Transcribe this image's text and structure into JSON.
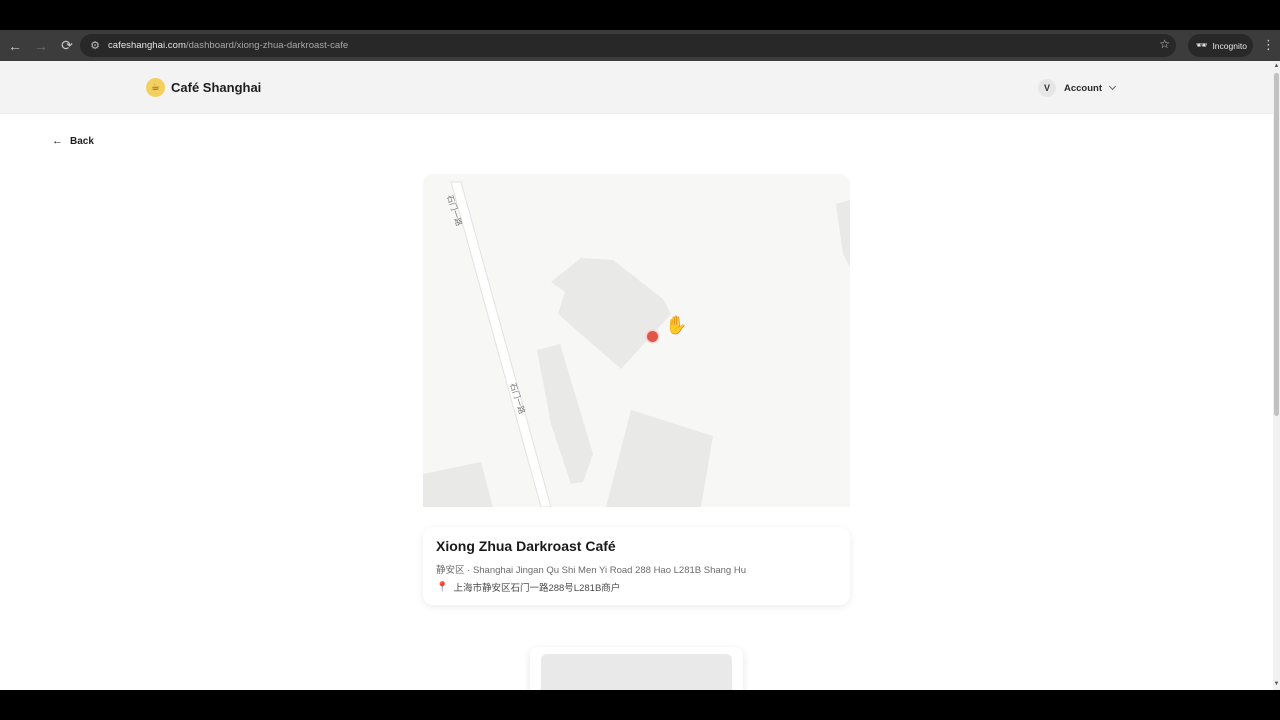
{
  "browser": {
    "url_host": "cafeshanghai.com",
    "url_path": "/dashboard/xiong-zhua-darkroast-cafe",
    "incognito_label": "Incognito"
  },
  "header": {
    "brand_name": "Café Shanghai",
    "account_initial": "V",
    "account_label": "Account"
  },
  "nav": {
    "back_label": "Back"
  },
  "map": {
    "street_label_top": "石门一路",
    "street_label_bottom": "石门一路",
    "marker_color": "#e0574a"
  },
  "cafe": {
    "name": "Xiong Zhua Darkroast Café",
    "subtitle": "静安区 · Shanghai Jingan Qu Shi Men Yi Road 288 Hao L281B Shang Hu",
    "address": "上海市静安区石门一路288号L281B商户"
  }
}
